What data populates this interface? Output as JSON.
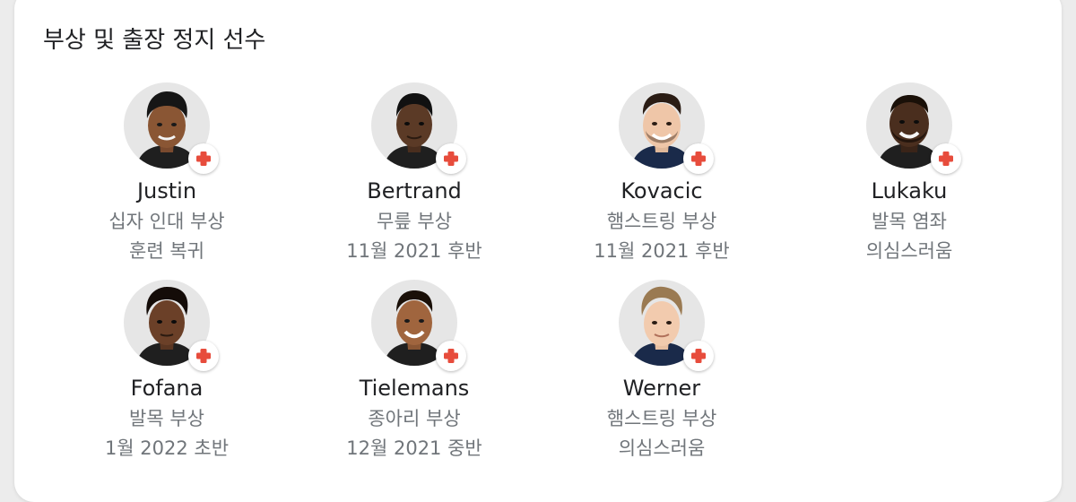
{
  "section": {
    "title": "부상 및 출장 정지 선수"
  },
  "colors": {
    "badge_cross": "#e74c3c",
    "avatar_bg": "#e6e6e6",
    "secondary_text": "#70757a"
  },
  "players": [
    {
      "name": "Justin",
      "injury": "십자 인대 부상",
      "status": "훈련 복귀",
      "icon": "medical-cross-icon"
    },
    {
      "name": "Bertrand",
      "injury": "무릎 부상",
      "status": "11월 2021 후반",
      "icon": "medical-cross-icon"
    },
    {
      "name": "Kovacic",
      "injury": "햄스트링 부상",
      "status": "11월 2021 후반",
      "icon": "medical-cross-icon"
    },
    {
      "name": "Lukaku",
      "injury": "발목 염좌",
      "status": "의심스러움",
      "icon": "medical-cross-icon"
    },
    {
      "name": "Fofana",
      "injury": "발목 부상",
      "status": "1월 2022 초반",
      "icon": "medical-cross-icon"
    },
    {
      "name": "Tielemans",
      "injury": "종아리 부상",
      "status": "12월 2021 중반",
      "icon": "medical-cross-icon"
    },
    {
      "name": "Werner",
      "injury": "햄스트링 부상",
      "status": "의심스러움",
      "icon": "medical-cross-icon"
    }
  ]
}
